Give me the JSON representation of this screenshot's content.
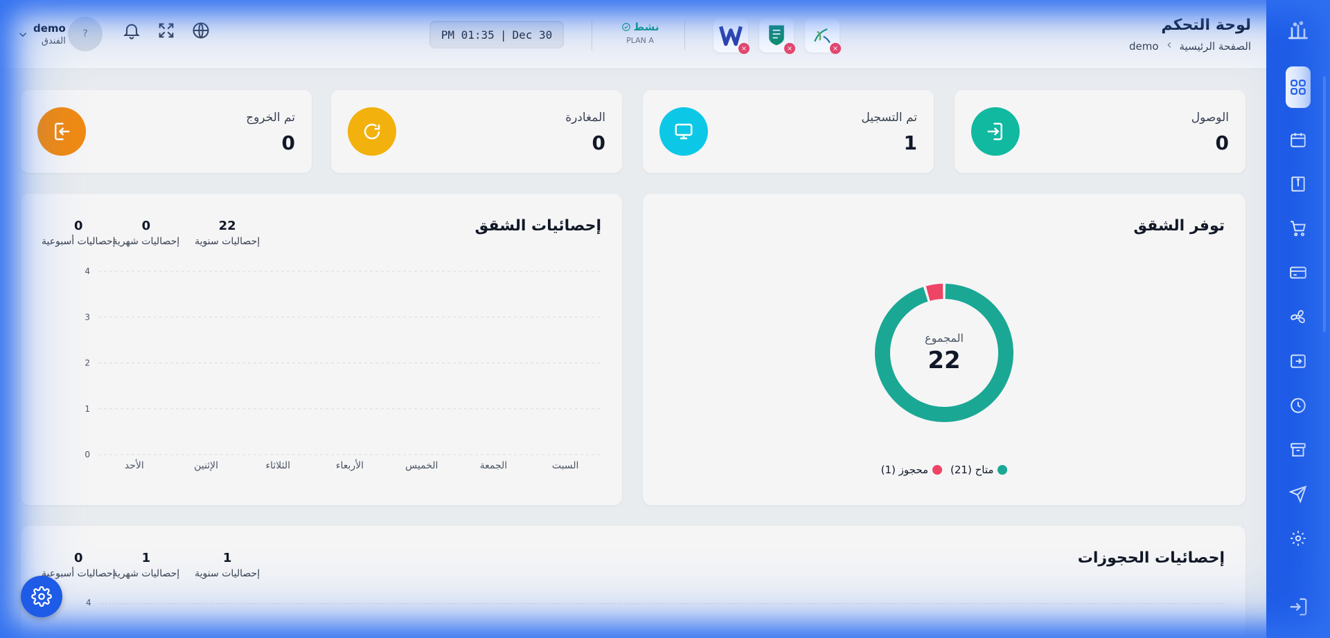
{
  "header": {
    "title": "لوحة التحكم",
    "breadcrumb": [
      "الصفحة الرئيسية",
      "demo"
    ],
    "plan_status": "نشط",
    "plan_name": "PLAN A",
    "clock": {
      "time": "PM 01:35",
      "date": "Dec 30"
    },
    "avatar_text": "?",
    "user_name": "demo",
    "user_role": "الفندق"
  },
  "stats": [
    {
      "label": "الوصول",
      "value": "0",
      "color": "#10b9a0"
    },
    {
      "label": "تم التسجيل",
      "value": "1",
      "color": "#0cc8e6"
    },
    {
      "label": "المغادرة",
      "value": "0",
      "color": "#f2b10c"
    },
    {
      "label": "تم الخروج",
      "value": "0",
      "color": "#f08a12"
    }
  ],
  "availability": {
    "title": "توفر الشقق",
    "total_label": "المجموع",
    "total": "22",
    "legend": [
      {
        "label": "متاح (21)",
        "color": "#1aa894"
      },
      {
        "label": "محجوز (1)",
        "color": "#ee4466"
      }
    ]
  },
  "apartment_stats": {
    "title": "إحصائيات الشقق",
    "yearly": {
      "value": "22",
      "label": "إحصاليات سنوية"
    },
    "monthly": {
      "value": "0",
      "label": "إحصاليات شهرية"
    },
    "weekly": {
      "value": "0",
      "label": "إحصاليات أسبوعية"
    }
  },
  "booking_stats": {
    "title": "إحصائيات الحجوزات",
    "yearly": {
      "value": "1",
      "label": "إحصاليات سنوية"
    },
    "monthly": {
      "value": "1",
      "label": "إحصاليات شهرية"
    },
    "weekly": {
      "value": "0",
      "label": "إحصاليات أسبوعية"
    },
    "y_top_tick": "4"
  },
  "chart_data": [
    {
      "type": "pie",
      "title": "توفر الشقق",
      "categories": [
        "متاح",
        "محجوز"
      ],
      "values": [
        21,
        1
      ],
      "colors": [
        "#1aa894",
        "#ee4466"
      ]
    },
    {
      "type": "bar",
      "title": "إحصائيات الشقق",
      "categories": [
        "السبت",
        "الجمعة",
        "الخميس",
        "الأربعاء",
        "الثلاثاء",
        "الإثنين",
        "الأحد"
      ],
      "values": [
        0,
        0,
        0,
        0,
        0,
        0,
        0
      ],
      "yticks": [
        "0",
        "1",
        "2",
        "3",
        "4"
      ],
      "ylim": [
        0,
        4
      ],
      "grid": true
    }
  ]
}
